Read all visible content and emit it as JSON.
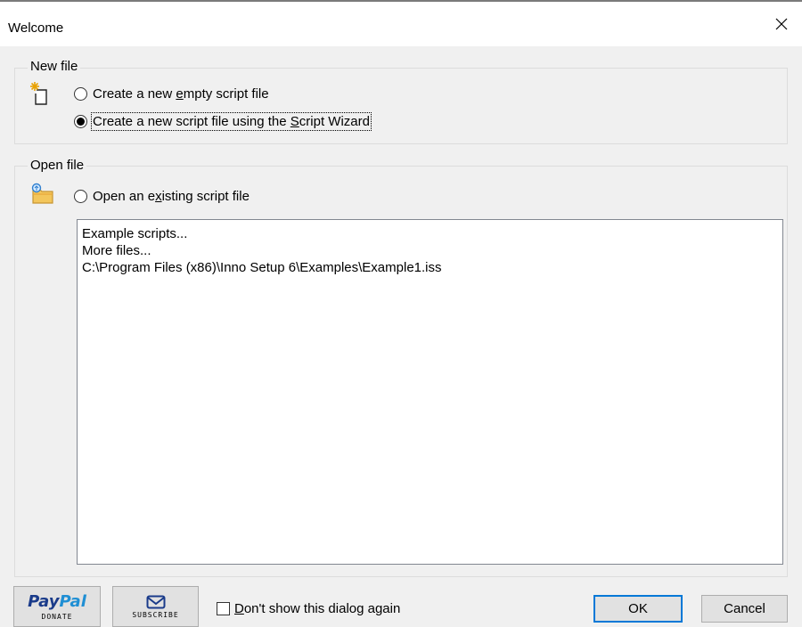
{
  "window": {
    "title": "Welcome",
    "close_glyph": "✕"
  },
  "new_file": {
    "group_label": "New file",
    "icon": "new-file-sparkle-icon",
    "option_empty": {
      "before": "Create a new ",
      "accel": "e",
      "after": "mpty script file",
      "checked": false
    },
    "option_wizard": {
      "before": "Create a new script file using the ",
      "accel": "S",
      "after": "cript Wizard",
      "checked": true
    }
  },
  "open_file": {
    "group_label": "Open file",
    "icon": "open-folder-icon",
    "option_existing": {
      "before": "Open an e",
      "accel": "x",
      "after": "isting script file",
      "checked": false
    },
    "recent_list": [
      "Example scripts...",
      "More files...",
      "C:\\Program Files (x86)\\Inno Setup 6\\Examples\\Example1.iss"
    ]
  },
  "footer": {
    "paypal_logo_pay": "Pay",
    "paypal_logo_pal": "Pal",
    "paypal_caption": "DONATE",
    "subscribe_caption": "SUBSCRIBE",
    "dont_show": {
      "accel": "D",
      "after": "on't show this dialog again",
      "checked": false
    },
    "ok_label": "OK",
    "cancel_label": "Cancel"
  },
  "colors": {
    "dialog_bg": "#f0f0f0",
    "default_button_border": "#0078d7",
    "paypal_dark_blue": "#1a3b8a",
    "paypal_light_blue": "#1f8fd4"
  }
}
